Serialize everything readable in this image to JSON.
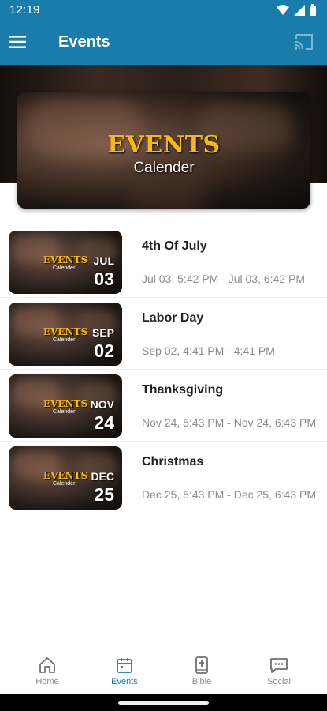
{
  "status_bar": {
    "time": "12:19"
  },
  "app_bar": {
    "title": "Events"
  },
  "hero": {
    "title": "EVENTS",
    "subtitle": "Calender"
  },
  "thumbnail_logo": {
    "title": "EVENTS",
    "subtitle": "Calender"
  },
  "events": [
    {
      "name": "4th Of July",
      "month": "JUL",
      "day": "03",
      "when": "Jul 03, 5:42 PM - Jul 03, 6:42 PM"
    },
    {
      "name": "Labor Day",
      "month": "SEP",
      "day": "02",
      "when": "Sep 02, 4:41 PM - 4:41 PM"
    },
    {
      "name": "Thanksgiving",
      "month": "NOV",
      "day": "24",
      "when": "Nov 24, 5:43 PM - Nov 24, 6:43 PM"
    },
    {
      "name": "Christmas",
      "month": "DEC",
      "day": "25",
      "when": "Dec 25, 5:43 PM - Dec 25, 6:43 PM"
    }
  ],
  "bottom_nav": [
    {
      "label": "Home",
      "icon": "home-icon"
    },
    {
      "label": "Events",
      "icon": "calendar-icon",
      "active": true
    },
    {
      "label": "Bible",
      "icon": "bible-icon"
    },
    {
      "label": "Social",
      "icon": "chat-icon"
    }
  ],
  "colors": {
    "primary": "#1a7cab",
    "accent_gold": "#f6b913",
    "muted_text": "#8b8b8b"
  }
}
